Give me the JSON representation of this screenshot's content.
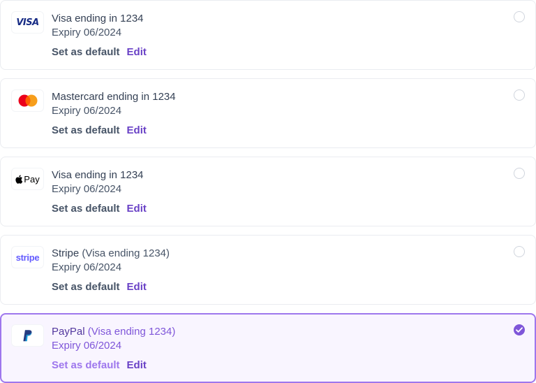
{
  "payment_methods": [
    {
      "brand_icon": "visa-logo",
      "name": "Visa ending in 1234",
      "name_suffix": "",
      "expiry": "Expiry 06/2024",
      "set_default_label": "Set as default",
      "edit_label": "Edit",
      "selected": false,
      "logo_text": "VISA"
    },
    {
      "brand_icon": "mastercard-logo",
      "name": "Mastercard ending in 1234",
      "name_suffix": "",
      "expiry": "Expiry 06/2024",
      "set_default_label": "Set as default",
      "edit_label": "Edit",
      "selected": false
    },
    {
      "brand_icon": "apple-pay-logo",
      "name": "Visa ending in 1234",
      "name_suffix": "",
      "expiry": "Expiry 06/2024",
      "set_default_label": "Set as default",
      "edit_label": "Edit",
      "selected": false,
      "logo_text": "Pay"
    },
    {
      "brand_icon": "stripe-logo",
      "name": "Stripe",
      "name_suffix": "(Visa ending 1234)",
      "expiry": "Expiry 06/2024",
      "set_default_label": "Set as default",
      "edit_label": "Edit",
      "selected": false,
      "logo_text": "stripe"
    },
    {
      "brand_icon": "paypal-logo",
      "name": "PayPal",
      "name_suffix": "(Visa ending 1234)",
      "expiry": "Expiry 06/2024",
      "set_default_label": "Set as default",
      "edit_label": "Edit",
      "selected": true
    }
  ],
  "colors": {
    "accent": "#7f56d9",
    "selected_bg": "#f9f5ff",
    "selected_border": "#9e77ed",
    "border": "#eaecf0",
    "visa_blue": "#172b85",
    "mastercard_red": "#eb001b",
    "mastercard_orange": "#f79e1b",
    "stripe_purple": "#635bff",
    "paypal_dark": "#253b80",
    "paypal_light": "#179bd7"
  }
}
